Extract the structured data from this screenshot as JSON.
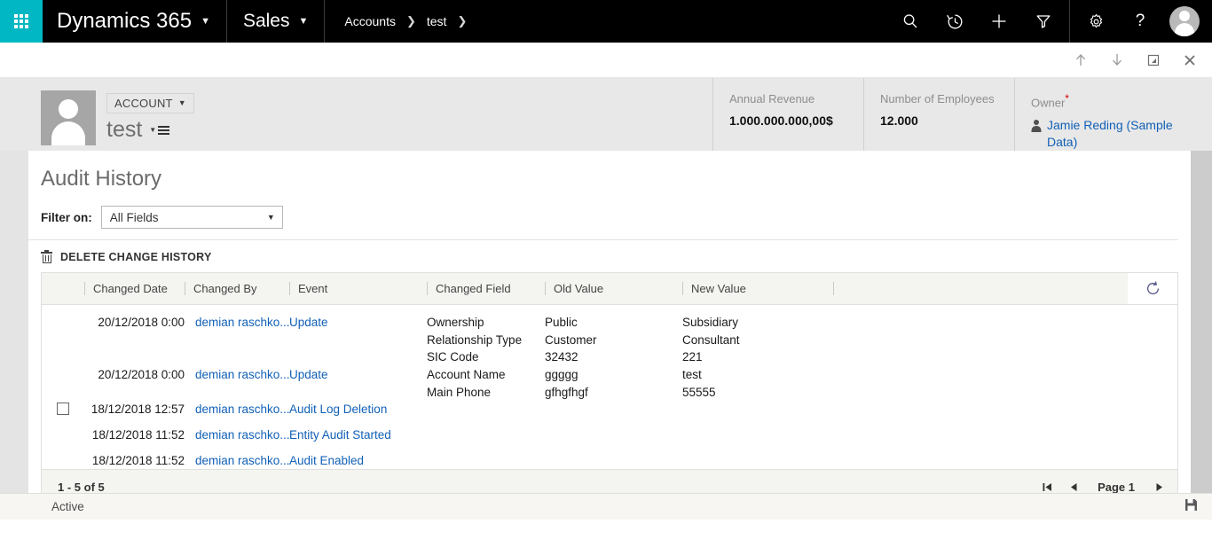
{
  "topnav": {
    "waffle_label": "app-launcher",
    "brand": "Dynamics 365",
    "app": "Sales",
    "breadcrumb": [
      "Accounts",
      "test"
    ],
    "icons": [
      "search-icon",
      "recent-icon",
      "quick-create-icon",
      "filter-icon",
      "settings-icon",
      "help-icon"
    ],
    "accent_color": "#00b7c3",
    "bar_color": "#000000"
  },
  "commandbar": {
    "up_label": "previous-record",
    "down_label": "next-record",
    "popout_label": "open-in-new-window",
    "close_label": "close"
  },
  "record": {
    "entity_type": "ACCOUNT",
    "title": "test",
    "stats": [
      {
        "label": "Annual Revenue",
        "value": "1.000.000.000,00$"
      },
      {
        "label": "Number of Employees",
        "value": "12.000"
      }
    ],
    "owner": {
      "label": "Owner",
      "required_mark": "*",
      "value": "Jamie Reding (Sample Data)"
    }
  },
  "panel": {
    "title": "Audit History",
    "filter": {
      "label": "Filter on:",
      "value": "All Fields"
    },
    "delete_action": "DELETE CHANGE HISTORY"
  },
  "grid": {
    "columns": [
      {
        "key": "check",
        "label": ""
      },
      {
        "key": "date",
        "label": "Changed Date"
      },
      {
        "key": "by",
        "label": "Changed By"
      },
      {
        "key": "event",
        "label": "Event"
      },
      {
        "key": "field",
        "label": "Changed Field"
      },
      {
        "key": "old",
        "label": "Old Value"
      },
      {
        "key": "new",
        "label": "New Value"
      },
      {
        "key": "extra",
        "label": ""
      }
    ],
    "refresh_label": "refresh-grid",
    "rows": [
      {
        "date": "20/12/2018 0:00",
        "by": "demian raschko...",
        "event": "Update",
        "fields": [
          "Ownership",
          "Relationship Type",
          "SIC Code"
        ],
        "old_values": [
          "Public",
          "Customer",
          "32432"
        ],
        "new_values": [
          "Subsidiary",
          "Consultant",
          "221"
        ],
        "checkbox": false
      },
      {
        "date": "20/12/2018 0:00",
        "by": "demian raschko...",
        "event": "Update",
        "fields": [
          "Account Name",
          "Main Phone"
        ],
        "old_values": [
          "ggggg",
          "gfhgfhgf"
        ],
        "new_values": [
          "test",
          "55555"
        ],
        "checkbox": false
      },
      {
        "date": "18/12/2018 12:57",
        "by": "demian raschko...",
        "event": "Audit Log Deletion",
        "fields": [],
        "old_values": [],
        "new_values": [],
        "checkbox": true
      },
      {
        "date": "18/12/2018 11:52",
        "by": "demian raschko...",
        "event": "Entity Audit Started",
        "fields": [],
        "old_values": [],
        "new_values": [],
        "checkbox": false
      },
      {
        "date": "18/12/2018 11:52",
        "by": "demian raschko...",
        "event": "Audit Enabled",
        "fields": [],
        "old_values": [],
        "new_values": [],
        "checkbox": false
      }
    ],
    "footer": {
      "count": "1 - 5 of 5",
      "page_label": "Page 1"
    }
  },
  "statusbar": {
    "status": "Active",
    "save_label": "save-record"
  },
  "colors": {
    "link": "#1160b7",
    "required": "#d60000",
    "header_band": "#e8e8e8"
  }
}
